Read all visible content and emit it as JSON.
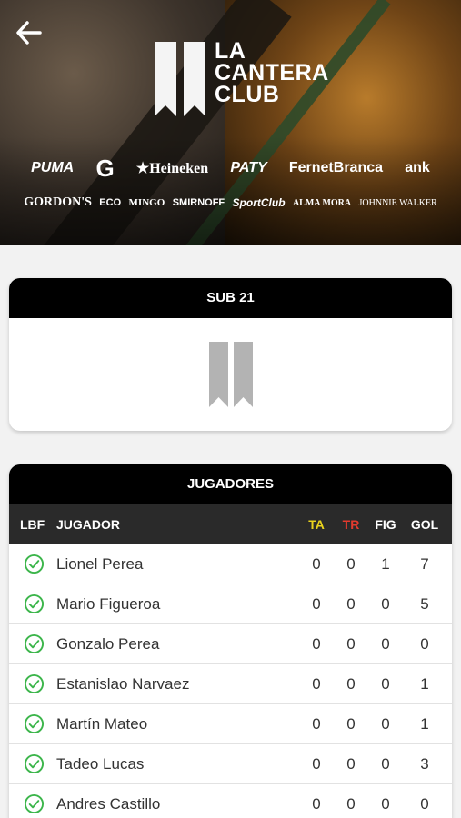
{
  "header": {
    "club_name_line1": "LA",
    "club_name_line2": "CANTERA",
    "club_name_line3": "CLUB",
    "sponsors_row1": [
      "PUMA",
      "G",
      "★Heineken",
      "PATY",
      "FernetBranca",
      "ank"
    ],
    "sponsors_row2": [
      "GORDON'S",
      "ECO",
      "MINGO",
      "SMIRNOFF",
      "SportClub",
      "ALMA MORA",
      "JOHNNIE WALKER"
    ]
  },
  "team": {
    "title": "SUB 21"
  },
  "players": {
    "title": "JUGADORES",
    "columns": {
      "lbf": "LBF",
      "name": "JUGADOR",
      "ta": "TA",
      "tr": "TR",
      "fig": "FIG",
      "gol": "GOL"
    },
    "rows": [
      {
        "name": "Lionel Perea",
        "ta": "0",
        "tr": "0",
        "fig": "1",
        "gol": "7"
      },
      {
        "name": "Mario Figueroa",
        "ta": "0",
        "tr": "0",
        "fig": "0",
        "gol": "5"
      },
      {
        "name": "Gonzalo Perea",
        "ta": "0",
        "tr": "0",
        "fig": "0",
        "gol": "0"
      },
      {
        "name": "Estanislao Narvaez",
        "ta": "0",
        "tr": "0",
        "fig": "0",
        "gol": "1"
      },
      {
        "name": "Martín Mateo",
        "ta": "0",
        "tr": "0",
        "fig": "0",
        "gol": "1"
      },
      {
        "name": "Tadeo Lucas",
        "ta": "0",
        "tr": "0",
        "fig": "0",
        "gol": "3"
      },
      {
        "name": "Andres Castillo",
        "ta": "0",
        "tr": "0",
        "fig": "0",
        "gol": "0"
      }
    ]
  },
  "colors": {
    "ta": "#e9d21d",
    "tr": "#e23a2e",
    "check": "#3bb54a",
    "header_bg": "#000000"
  },
  "icons": {
    "back": "arrow-left-icon",
    "check": "check-circle-icon",
    "club_logo": "club-logo-icon",
    "team_badge": "team-badge-icon"
  }
}
